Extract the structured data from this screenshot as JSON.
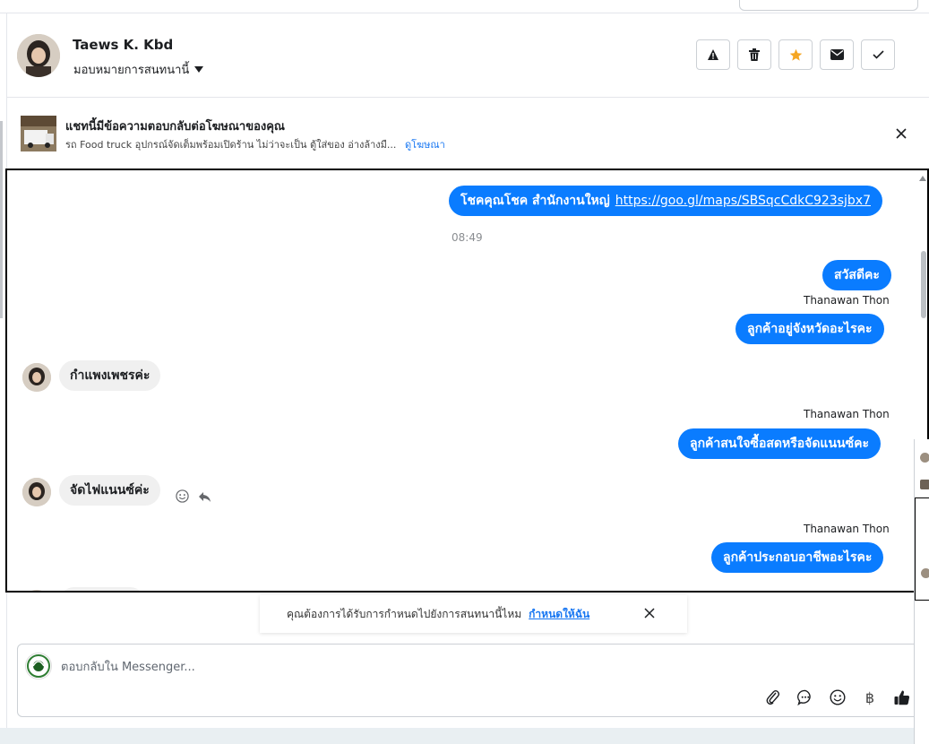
{
  "header": {
    "contact_name": "Taews K. Kbd",
    "assign_label": "มอบหมายการสนทนานี้",
    "actions": [
      {
        "name": "report-button",
        "icon": "warning-icon"
      },
      {
        "name": "delete-button",
        "icon": "trash-icon"
      },
      {
        "name": "star-button",
        "icon": "star-icon",
        "color": "#f5a623"
      },
      {
        "name": "mark-unread-button",
        "icon": "envelope-icon"
      },
      {
        "name": "mark-done-button",
        "icon": "check-icon"
      }
    ]
  },
  "ad_banner": {
    "title": "แชทนี้มีข้อความตอบกลับต่อโฆษณาของคุณ",
    "description": "รถ Food truck อุปกรณ์จัดเต็มพร้อมเปิดร้าน ไม่ว่าจะเป็น ตู้ใส่ของ อ่างล้างมื...",
    "link_label": "ดูโฆษณา"
  },
  "conversation": {
    "m1_text": "โชคคุณโชค สำนักงานใหญ่",
    "m1_link": "https://goo.gl/maps/SBSqcCdkC923sjbx7",
    "timestamp": "08:49",
    "m2": "สวัสดีคะ",
    "sender": "Thanawan Thon",
    "m3": "ลูกค้าอยู่จังหวัดอะไรคะ",
    "m4": "กำแพงเพชรค่ะ",
    "m5": "ลูกค้าสนใจซื้อสดหรือจัดแนนซ์คะ",
    "m6": "จัดไฟแนนซ์ค่ะ",
    "m7": "ลูกค้าประกอบอาชีพอะไรคะ"
  },
  "assign_prompt": {
    "text": "คุณต้องการได้รับการกำหนดไปยังการสนทนานี้ไหม",
    "link_label": "กำหนดให้ฉัน"
  },
  "composer": {
    "placeholder": "ตอบกลับใน Messenger...",
    "tools": [
      "attachment-icon",
      "saved-reply-icon",
      "emoji-icon",
      "baht-icon",
      "like-icon"
    ],
    "currency_symbol": "฿"
  },
  "colors": {
    "accent": "#0a7cff",
    "link": "#1877f2",
    "incoming_bubble": "#f0f0f0"
  }
}
